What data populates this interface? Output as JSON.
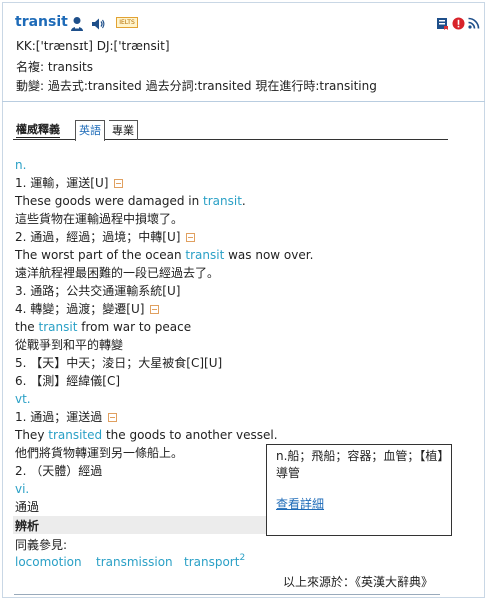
{
  "header": {
    "word": "transit",
    "ielts_badge": "IELTS",
    "pronunciation": "KK:['trænsɪt] DJ:['trænsit]",
    "noun_forms": "名複: transits",
    "verb_forms": "動變: 過去式:transited  過去分詞:transited  現在進行時:transiting",
    "icons": [
      "person-icon",
      "speaker-icon",
      "book-icon",
      "report-icon",
      "rss-icon"
    ]
  },
  "tabs": {
    "authority": "權威釋義",
    "english_chinese": "英語",
    "professional": "專業"
  },
  "entries": {
    "pos_n": "n.",
    "n1": "1. 運輸，運送[U]",
    "n1_ex_pre": "These goods were damaged in ",
    "n1_ex_hl": "transit",
    "n1_ex_post": ".",
    "n1_tr": "這些貨物在運輸過程中損壞了。",
    "n2": "2. 通過，經過；過境；中轉[U]",
    "n2_ex_pre": "The worst part of the ocean ",
    "n2_ex_hl": "transit",
    "n2_ex_post": " was now over.",
    "n2_tr": "遠洋航程裡最困難的一段已經過去了。",
    "n3": "3. 通路；公共交通運輸系統[U]",
    "n4": "4. 轉變；過渡；變遷[U]",
    "n4_ex_pre": "the ",
    "n4_ex_hl": "transit",
    "n4_ex_post": " from war to peace",
    "n4_tr": "從戰爭到和平的轉變",
    "n5": "5. 【天】中天；淩日；大星被食[C][U]",
    "n6": "6. 【測】經緯儀[C]",
    "pos_vt": "vt.",
    "vt1": "1. 通過；運送過",
    "vt1_ex_pre": "They ",
    "vt1_ex_hl": "transited",
    "vt1_ex_post": " the goods to another vessel.",
    "vt1_tr": "他們將貨物轉運到另一條船上。",
    "vt2": "2. （天體）經過",
    "pos_vi": "vi.",
    "vi1": "通過"
  },
  "analysis": {
    "label": "辨析",
    "see_also": "同義參見:",
    "links": [
      "locomotion",
      "transmission",
      "transport"
    ],
    "transport_sup": "2"
  },
  "popup": {
    "text": "n.船；飛船；容器；血管；【植】導管",
    "link": "查看詳細"
  },
  "footer": {
    "source": "以上來源於：《英漢大辭典》"
  },
  "colors": {
    "title": "#1e6bb8",
    "highlight": "#2aa0c6",
    "expand": "#e0a060"
  }
}
